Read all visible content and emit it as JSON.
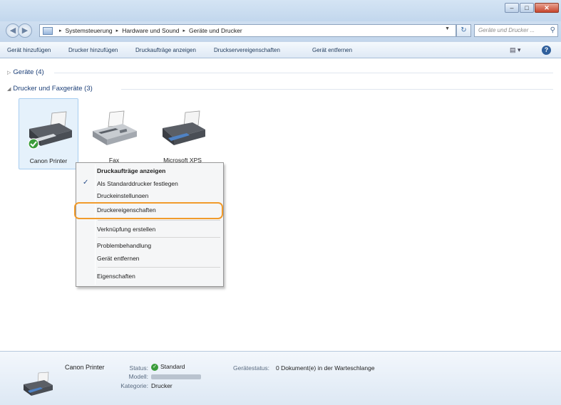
{
  "window": {
    "min_glyph": "–",
    "max_glyph": "□",
    "close_glyph": "✕"
  },
  "address": {
    "crumbs": [
      "Systemsteuerung",
      "Hardware und Sound",
      "Geräte und Drucker"
    ],
    "separator": "▸",
    "search_placeholder": "Geräte und Drucker ..."
  },
  "toolbar": {
    "items": [
      "Gerät hinzufügen",
      "Drucker hinzufügen",
      "Druckaufträge anzeigen",
      "Druckservereigenschaften",
      "Gerät entfernen"
    ],
    "view_label": "▤ ▾",
    "help_label": "?"
  },
  "groups": {
    "devices": {
      "label": "Geräte (4)",
      "expander": "▷"
    },
    "printers": {
      "label": "Drucker und Faxgeräte (3)",
      "expander": "◢"
    }
  },
  "printers": [
    {
      "name": "Canon Printer",
      "selected": true,
      "default": true
    },
    {
      "name": "Fax",
      "selected": false,
      "default": false
    },
    {
      "name": "Microsoft XPS",
      "selected": false,
      "default": false
    }
  ],
  "context_menu": {
    "items": [
      {
        "label": "Druckaufträge anzeigen",
        "bold": true
      },
      {
        "label": "Als Standarddrucker festlegen",
        "checked": true
      },
      {
        "label": "Druckeinstellungen",
        "partial": true
      },
      {
        "label": "Druckereigenschaften",
        "highlighted": true
      },
      {
        "label": "Verknüpfung erstellen"
      },
      {
        "label": "Problembehandlung"
      },
      {
        "label": "Gerät entfernen"
      },
      {
        "label": "Eigenschaften"
      }
    ],
    "check_glyph": "✓"
  },
  "details": {
    "name": "Canon Printer",
    "status_label": "Status:",
    "status_value": "Standard",
    "model_label": "Modell:",
    "category_label": "Kategorie:",
    "category_value": "Drucker",
    "device_status_label": "Gerätestatus:",
    "device_status_value": "0 Dokument(e) in der Warteschlange"
  },
  "colors": {
    "highlight_ring": "#f19b2c",
    "default_badge": "#3a9c3a",
    "group_text": "#1c3f77"
  }
}
